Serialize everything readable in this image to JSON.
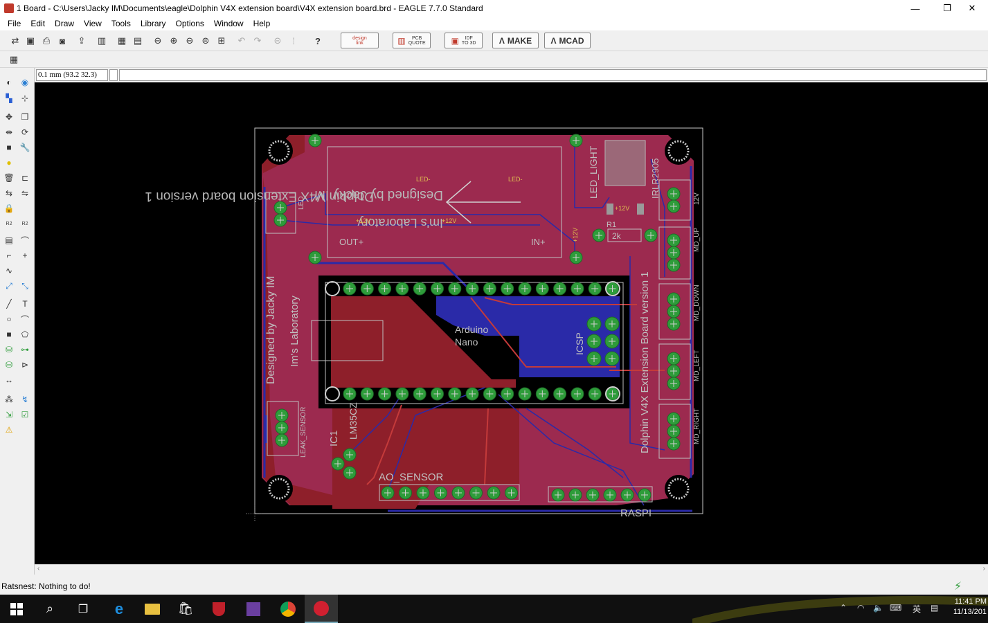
{
  "window": {
    "title": "1 Board - C:\\Users\\Jacky IM\\Documents\\eagle\\Dolphin V4X extension board\\V4X extension board.brd - EAGLE 7.7.0 Standard",
    "controls": {
      "minimize": "—",
      "maximize": "❐",
      "close": "✕"
    }
  },
  "menu": [
    "File",
    "Edit",
    "Draw",
    "View",
    "Tools",
    "Library",
    "Options",
    "Window",
    "Help"
  ],
  "toolbar": {
    "designlink_top": "design",
    "designlink_bottom": "link",
    "pcbquote_top": "PCB",
    "pcbquote_bottom": "QUOTE",
    "idf_top": "IDF",
    "idf_bottom": "TO 3D",
    "make_label": "MAKE",
    "mcad_label": "MCAD"
  },
  "command": {
    "coordinate": "0.1 mm (93.2 32.3)",
    "input_value": ""
  },
  "board": {
    "title_line1": "Dolphin V4X Extension board version 1",
    "title_line2": "Designed by Jacky IM",
    "title_line3": "Im's Laboratory",
    "side_text_designed": "Designed by Jacky IM",
    "side_text_lab": "Im's Laboratory",
    "side_text_version": "Dolphin V4X Extension Board version 1",
    "arduino_line1": "Arduino",
    "arduino_line2": "Nano",
    "icsp": "ICSP",
    "led_label": "LED",
    "led_light": "LED_LIGHT",
    "irlr": "IRLR2905",
    "label_12v": "12V",
    "md_up": "MD_UP",
    "md_down": "MD_DOWN",
    "md_left": "MD_LEFT",
    "md_right": "MD_RIGHT",
    "leak_sensor": "LEAK_SENSOR",
    "ic1": "IC1",
    "lm35": "LM35CZ",
    "ao_sensor": "AO_SENSOR",
    "raspi": "RASPI",
    "r1": "R1",
    "r1_value": "2k",
    "out_plus": "OUT+",
    "in_plus": "IN+",
    "led_minus": "LED-",
    "plus12v": "+12V"
  },
  "status": {
    "message": "Ratsnest: Nothing to do!"
  },
  "taskbar": {
    "time": "11:41 PM",
    "date": "11/13/201",
    "ime": "英"
  },
  "colors": {
    "board_top": "#9c2a4f",
    "board_red": "#8e1f2a",
    "bottom_blue": "#2a2aa8",
    "pad_green": "#2e9c3a",
    "outline": "#c8c8c8",
    "silk": "#c0c0c0"
  }
}
